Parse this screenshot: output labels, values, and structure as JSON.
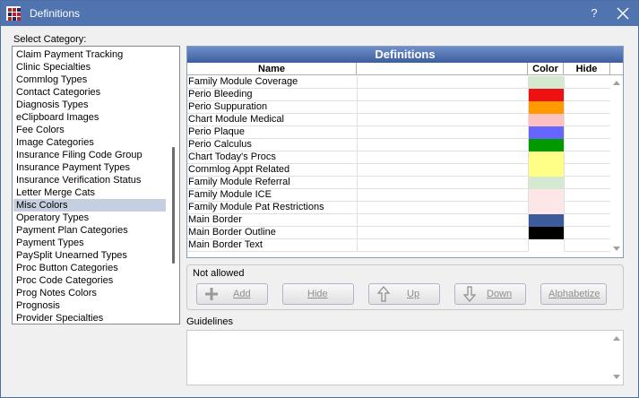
{
  "window": {
    "title": "Definitions",
    "help_label": "?"
  },
  "categories": {
    "label": "Select Category:",
    "items": [
      "Claim Payment Tracking",
      "Clinic Specialties",
      "Commlog Types",
      "Contact Categories",
      "Diagnosis Types",
      "eClipboard Images",
      "Fee Colors",
      "Image Categories",
      "Insurance Filing Code Group",
      "Insurance Payment Types",
      "Insurance Verification Status",
      "Letter Merge Cats",
      "Misc Colors",
      "Operatory Types",
      "Payment Plan Categories",
      "Payment Types",
      "PaySplit Unearned Types",
      "Proc Button Categories",
      "Proc Code Categories",
      "Prog Notes Colors",
      "Prognosis",
      "Provider Specialties"
    ],
    "selected": "Misc Colors"
  },
  "definitions": {
    "header": "Definitions",
    "columns": {
      "name": "Name",
      "color": "Color",
      "hide": "Hide"
    },
    "rows": [
      {
        "name": "Family Module Coverage",
        "color": "#d5e8d0"
      },
      {
        "name": "Perio Bleeding",
        "color": "#ee1111"
      },
      {
        "name": "Perio Suppuration",
        "color": "#ff9900"
      },
      {
        "name": "Chart Module Medical",
        "color": "#ffc0c0"
      },
      {
        "name": "Perio Plaque",
        "color": "#6666ff"
      },
      {
        "name": "Perio Calculus",
        "color": "#009900"
      },
      {
        "name": "Chart Today's Procs",
        "color": "#ffff88"
      },
      {
        "name": "Commlog Appt Related",
        "color": "#ffff88"
      },
      {
        "name": "Family Module Referral",
        "color": "#d5e8d0"
      },
      {
        "name": "Family Module ICE",
        "color": "#fde6e6"
      },
      {
        "name": "Family Module Pat Restrictions",
        "color": "#fde6e6"
      },
      {
        "name": "Main Border",
        "color": "#3b5b9c"
      },
      {
        "name": "Main Border Outline",
        "color": "#000000"
      },
      {
        "name": "Main Border Text",
        "color": "#ffffff"
      }
    ]
  },
  "actions": {
    "status": "Not allowed",
    "add": "Add",
    "hide": "Hide",
    "up": "Up",
    "down": "Down",
    "alphabetize": "Alphabetize"
  },
  "guidelines": {
    "label": "Guidelines",
    "text": ""
  }
}
